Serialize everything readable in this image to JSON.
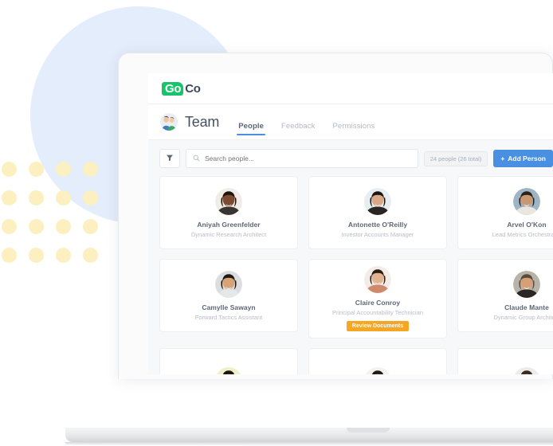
{
  "brand": {
    "logo_go": "Go",
    "logo_co": "Co",
    "logo_green": "#17c46b"
  },
  "header": {
    "title": "Team",
    "avatar_icon": "team-avatar-icon",
    "tabs": [
      {
        "label": "People",
        "active": true
      },
      {
        "label": "Feedback",
        "active": false
      },
      {
        "label": "Permissions",
        "active": false
      }
    ],
    "accent_color": "#4a90e2"
  },
  "toolbar": {
    "filter_icon": "filter-icon",
    "search_icon": "search-icon",
    "search_value": "",
    "search_placeholder": "Search people...",
    "people_count": "24 people (26 total)",
    "add_person_label": "Add Person",
    "add_person_plus": "+",
    "add_person_color": "#4a90e2"
  },
  "people": [
    {
      "name": "Aniyah Greenfelder",
      "role": "Dynamic Research Architect",
      "badge": null,
      "avatar": {
        "skin": "#7b4b32",
        "hair": "#21160f",
        "shirt": "#3a3530",
        "bg": "#f2ece6"
      }
    },
    {
      "name": "Antonette O'Reilly",
      "role": "Investor Accounts Manager",
      "badge": null,
      "avatar": {
        "skin": "#d9a888",
        "hair": "#1b1512",
        "shirt": "#2a2522",
        "bg": "#e7eef1"
      }
    },
    {
      "name": "Arvel O'Kon",
      "role": "Lead Metrics Orchestrator",
      "badge": null,
      "avatar": {
        "skin": "#c99873",
        "hair": "#2c2119",
        "shirt": "#e9e6df",
        "bg": "#9fb4c4"
      }
    },
    {
      "name": "Camylle Sawayn",
      "role": "Forward Tactics Assistant",
      "badge": null,
      "avatar": {
        "skin": "#d8a277",
        "hair": "#201812",
        "shirt": "#e6e7e9",
        "bg": "#dcdddf"
      }
    },
    {
      "name": "Claire Conroy",
      "role": "Principal Accountability Technician",
      "badge": {
        "label": "Review Documents",
        "color": "#f5a623"
      },
      "avatar": {
        "skin": "#e0b393",
        "hair": "#2b1d14",
        "shirt": "#cf8a6d",
        "bg": "#f3ece8"
      }
    },
    {
      "name": "Claude Mante",
      "role": "Dynamic Group Architect",
      "badge": null,
      "avatar": {
        "skin": "#d5a078",
        "hair": "#5a4a3c",
        "shirt": "#2b2723",
        "bg": "#b7b3ab"
      }
    },
    {
      "name": "",
      "role": "",
      "badge": null,
      "avatar": {
        "skin": "#8c5a3a",
        "hair": "#1d140e",
        "shirt": "#2f2a26",
        "bg": "#f0efc9"
      }
    },
    {
      "name": "",
      "role": "",
      "badge": null,
      "avatar": {
        "skin": "#cf9f7c",
        "hair": "#241a13",
        "shirt": "#efeeea",
        "bg": "#f4f2f0"
      }
    },
    {
      "name": "",
      "role": "",
      "badge": null,
      "avatar": {
        "skin": "#d6a47f",
        "hair": "#3a2a1d",
        "shirt": "#35302b",
        "bg": "#eceaea"
      }
    }
  ],
  "decor": {
    "circle_color": "#e3edfb",
    "dot_color": "#fcefc0",
    "dot_rows": 4,
    "dot_cols": 4
  }
}
